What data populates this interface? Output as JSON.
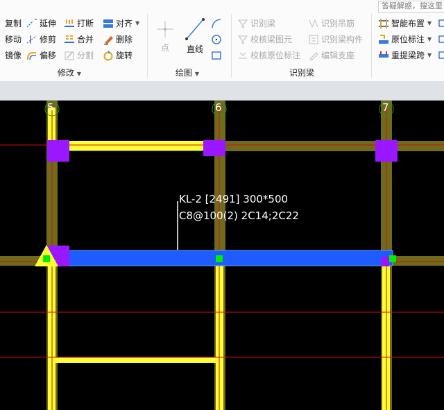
{
  "search": {
    "placeholder": "答疑解惑，搜这里"
  },
  "modify_group": {
    "label": "修改",
    "commands": [
      {
        "label": "复制"
      },
      {
        "label": "延伸"
      },
      {
        "label": "打断"
      },
      {
        "label": "对齐"
      },
      {
        "label": "移动"
      },
      {
        "label": "修剪"
      },
      {
        "label": "合并"
      },
      {
        "label": "删除"
      },
      {
        "label": "镜像"
      },
      {
        "label": "偏移"
      },
      {
        "label": "分割"
      },
      {
        "label": "旋转"
      }
    ]
  },
  "draw_group": {
    "label": "绘图",
    "point_label": "点",
    "line_label": "直线"
  },
  "recognize_group": {
    "label": "识别梁",
    "commands": [
      {
        "label": "识别梁"
      },
      {
        "label": "识别吊筋"
      },
      {
        "label": "校核梁图元"
      },
      {
        "label": "识别梁构件"
      },
      {
        "label": "校核原位标注"
      },
      {
        "label": "编辑支座"
      }
    ]
  },
  "beam_group": {
    "commands": [
      {
        "label": "智能布置"
      },
      {
        "label": "原位标注"
      },
      {
        "label": "重提梁跨"
      }
    ]
  },
  "canvas": {
    "axes": [
      {
        "label": "5"
      },
      {
        "label": "6"
      },
      {
        "label": "7"
      }
    ],
    "beam_annotation": {
      "line1": "KL-2 [2491] 300*500",
      "line2": "C8@100(2) 2C14;2C22"
    },
    "colors": {
      "background": "#000000",
      "beam_yellow": "#ffff33",
      "beam_olive": "#6f6a1c",
      "column_purple": "#9a17ff",
      "selected_beam": "#1f5cff",
      "grid_line": "#cc1111",
      "grip": "#00ee00"
    }
  }
}
